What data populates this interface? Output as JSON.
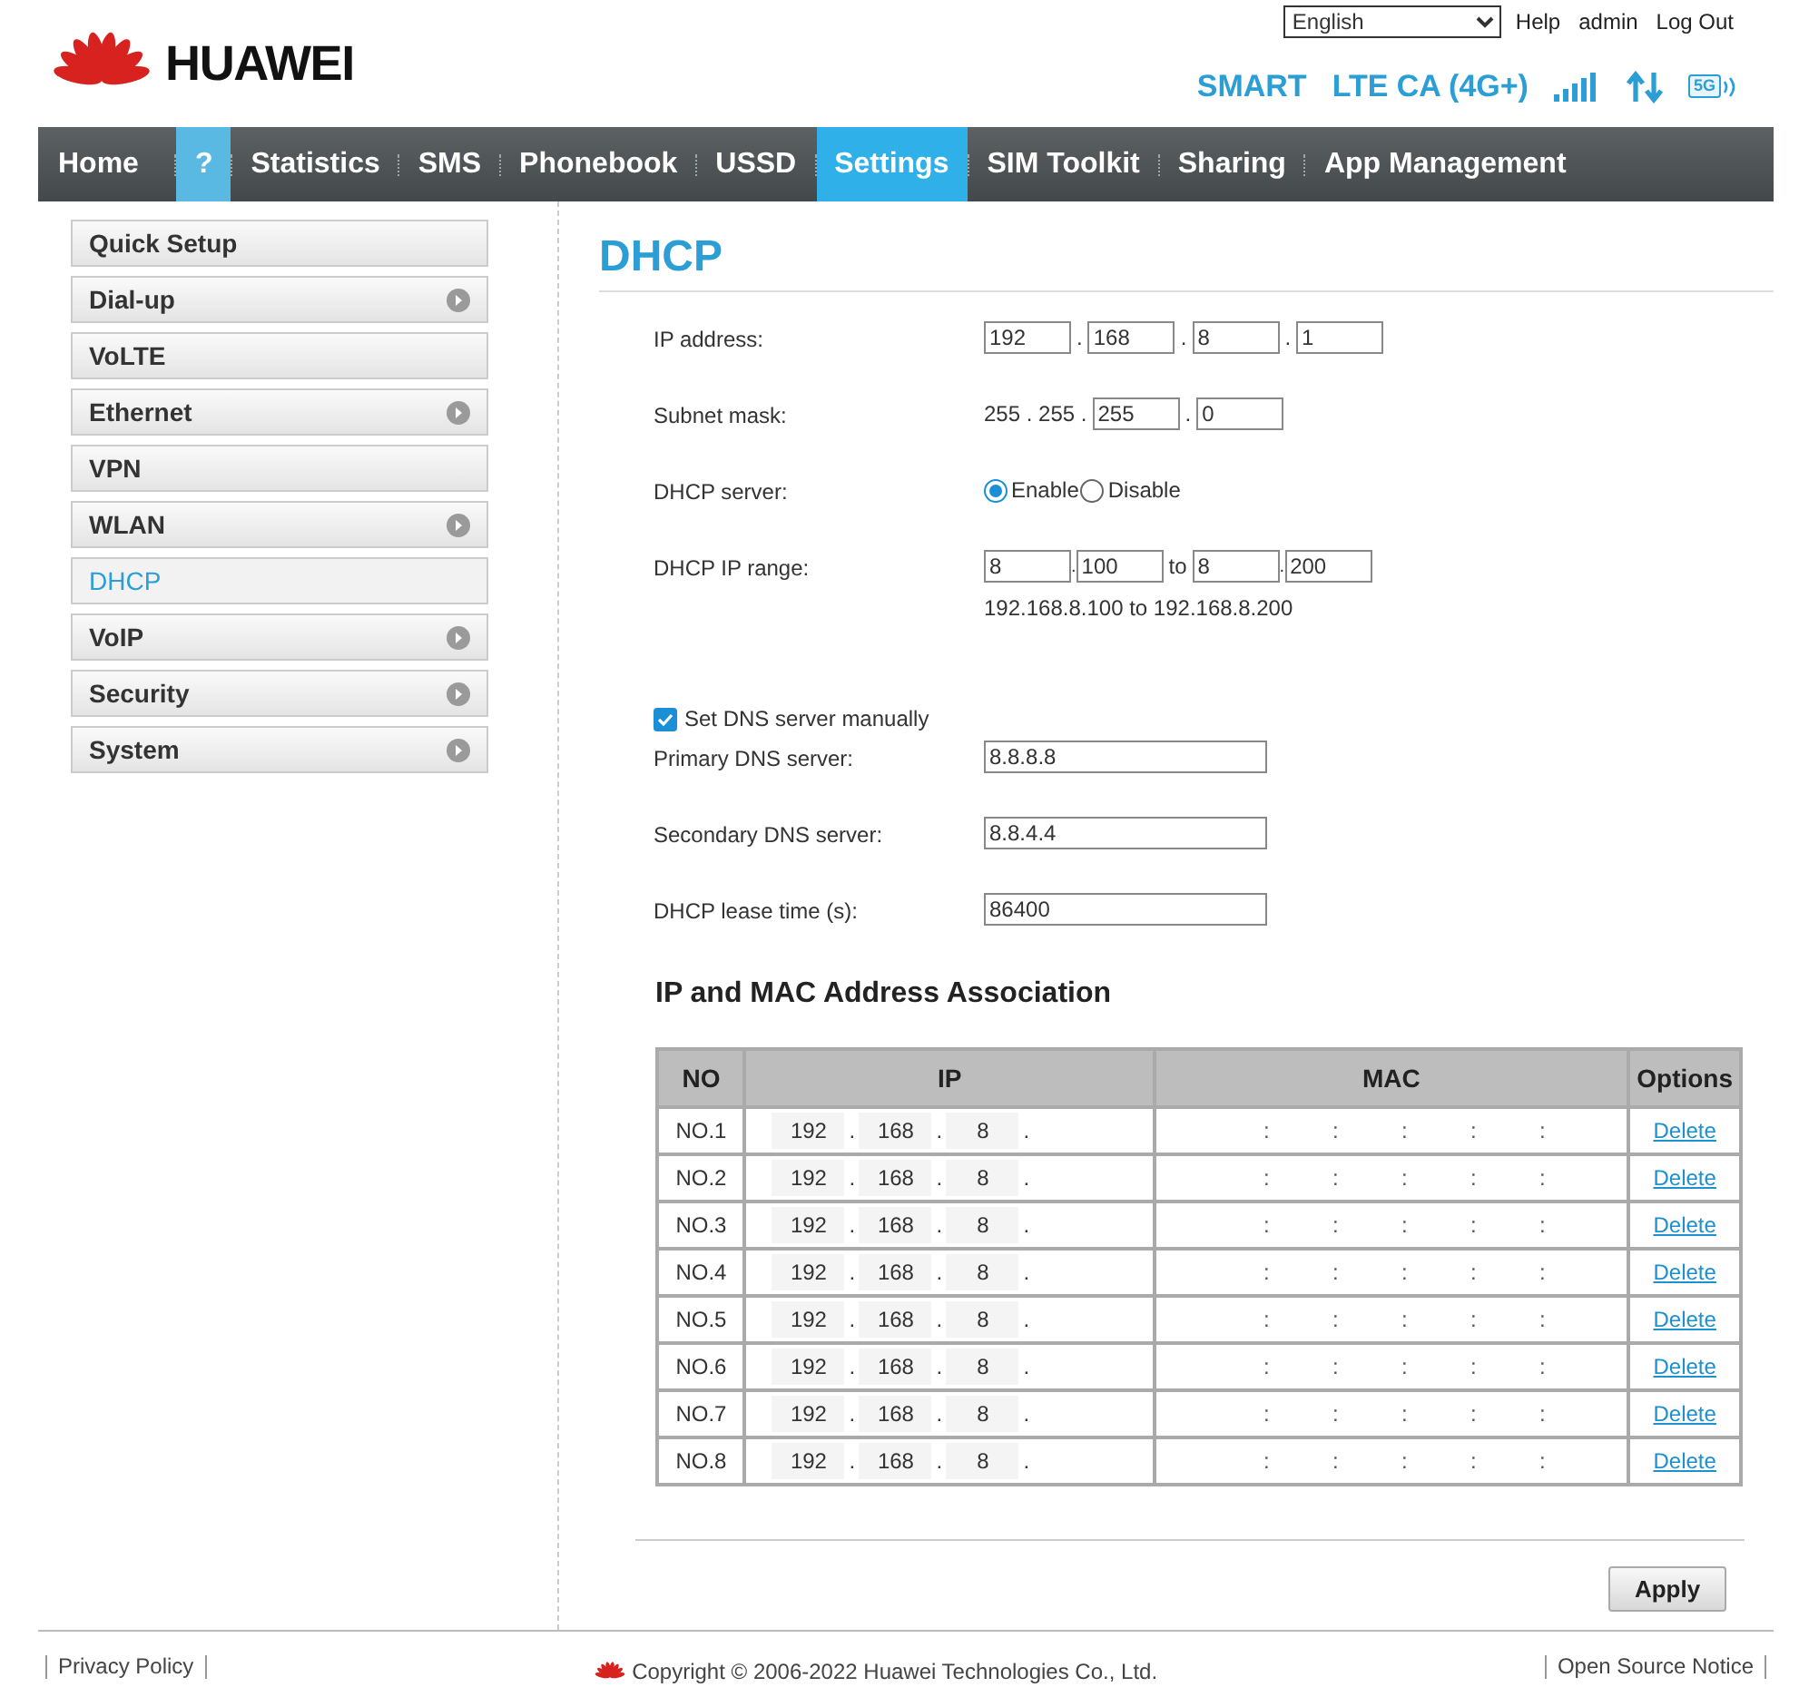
{
  "brand": {
    "name": "HUAWEI"
  },
  "top_links": {
    "language": "English",
    "links": [
      "Help",
      "admin",
      "Log Out"
    ]
  },
  "status": {
    "operator": "SMART",
    "network": "LTE CA (4G+)",
    "badge": "5G"
  },
  "nav": [
    {
      "label": "Home",
      "selected": false
    },
    {
      "label": "?",
      "selected": false,
      "highlight": true
    },
    {
      "label": "Statistics",
      "selected": false
    },
    {
      "label": "SMS",
      "selected": false
    },
    {
      "label": "Phonebook",
      "selected": false
    },
    {
      "label": "USSD",
      "selected": false
    },
    {
      "label": "Settings",
      "selected": true
    },
    {
      "label": "SIM Toolkit",
      "selected": false
    },
    {
      "label": "Sharing",
      "selected": false
    },
    {
      "label": "App Management",
      "selected": false
    }
  ],
  "sidebar": {
    "items": [
      {
        "label": "Quick Setup",
        "selected": false,
        "has_submenu": false
      },
      {
        "label": "Dial-up",
        "selected": false,
        "has_submenu": true
      },
      {
        "label": "VoLTE",
        "selected": false,
        "has_submenu": false
      },
      {
        "label": "Ethernet",
        "selected": false,
        "has_submenu": true
      },
      {
        "label": "VPN",
        "selected": false,
        "has_submenu": false
      },
      {
        "label": "WLAN",
        "selected": false,
        "has_submenu": true
      },
      {
        "label": "DHCP",
        "selected": true,
        "has_submenu": false
      },
      {
        "label": "VoIP",
        "selected": false,
        "has_submenu": true
      },
      {
        "label": "Security",
        "selected": false,
        "has_submenu": true
      },
      {
        "label": "System",
        "selected": false,
        "has_submenu": true
      }
    ]
  },
  "page": {
    "title": "DHCP"
  },
  "form": [
    {
      "kind": "ip",
      "label": "IP address:",
      "fields": [
        "192",
        "168",
        "8",
        "1"
      ],
      "separators": [
        ".",
        ".",
        "."
      ]
    },
    {
      "kind": "mask",
      "label": "Subnet mask:",
      "fixed": "255 . 255 .",
      "fields": [
        "255",
        "0"
      ],
      "separators": [
        "."
      ]
    },
    {
      "kind": "radio",
      "label": "DHCP server:",
      "options": [
        {
          "label": "Enable",
          "selected": true
        },
        {
          "label": "Disable",
          "selected": false
        }
      ]
    },
    {
      "kind": "range",
      "label": "DHCP IP range:",
      "start": [
        "8",
        "100"
      ],
      "start_separator": ".",
      "to": "to",
      "end": [
        "8",
        "200"
      ],
      "end_separator": ".",
      "summary": "192.168.8.100 to 192.168.8.200"
    },
    {
      "kind": "checkbox",
      "label": "Set DNS server manually",
      "checked": true
    },
    {
      "kind": "text",
      "label": "Primary DNS server:",
      "value": "8.8.8.8"
    },
    {
      "kind": "text",
      "label": "Secondary DNS server:",
      "value": "8.8.4.4"
    },
    {
      "kind": "text",
      "label": "DHCP lease time (s):",
      "value": "86400"
    }
  ],
  "association": {
    "title": "IP and MAC Address Association",
    "columns": [
      "NO",
      "IP",
      "MAC",
      "Options"
    ],
    "rows": [
      {
        "no": "NO.1",
        "ip": [
          "192",
          "168",
          "8"
        ],
        "ip_separators": [
          ".",
          ".",
          "."
        ],
        "mac_separators": [
          ":",
          ":",
          ":",
          ":",
          ":"
        ],
        "action": "Delete"
      },
      {
        "no": "NO.2",
        "ip": [
          "192",
          "168",
          "8"
        ],
        "ip_separators": [
          ".",
          ".",
          "."
        ],
        "mac_separators": [
          ":",
          ":",
          ":",
          ":",
          ":"
        ],
        "action": "Delete"
      },
      {
        "no": "NO.3",
        "ip": [
          "192",
          "168",
          "8"
        ],
        "ip_separators": [
          ".",
          ".",
          "."
        ],
        "mac_separators": [
          ":",
          ":",
          ":",
          ":",
          ":"
        ],
        "action": "Delete"
      },
      {
        "no": "NO.4",
        "ip": [
          "192",
          "168",
          "8"
        ],
        "ip_separators": [
          ".",
          ".",
          "."
        ],
        "mac_separators": [
          ":",
          ":",
          ":",
          ":",
          ":"
        ],
        "action": "Delete"
      },
      {
        "no": "NO.5",
        "ip": [
          "192",
          "168",
          "8"
        ],
        "ip_separators": [
          ".",
          ".",
          "."
        ],
        "mac_separators": [
          ":",
          ":",
          ":",
          ":",
          ":"
        ],
        "action": "Delete"
      },
      {
        "no": "NO.6",
        "ip": [
          "192",
          "168",
          "8"
        ],
        "ip_separators": [
          ".",
          ".",
          "."
        ],
        "mac_separators": [
          ":",
          ":",
          ":",
          ":",
          ":"
        ],
        "action": "Delete"
      },
      {
        "no": "NO.7",
        "ip": [
          "192",
          "168",
          "8"
        ],
        "ip_separators": [
          ".",
          ".",
          "."
        ],
        "mac_separators": [
          ":",
          ":",
          ":",
          ":",
          ":"
        ],
        "action": "Delete"
      },
      {
        "no": "NO.8",
        "ip": [
          "192",
          "168",
          "8"
        ],
        "ip_separators": [
          ".",
          ".",
          "."
        ],
        "mac_separators": [
          ":",
          ":",
          ":",
          ":",
          ":"
        ],
        "action": "Delete"
      }
    ]
  },
  "apply_button": "Apply",
  "footer": {
    "left": "Privacy Policy",
    "copyright": "Copyright © 2006-2022 Huawei Technologies Co., Ltd.",
    "right": "Open Source Notice"
  }
}
